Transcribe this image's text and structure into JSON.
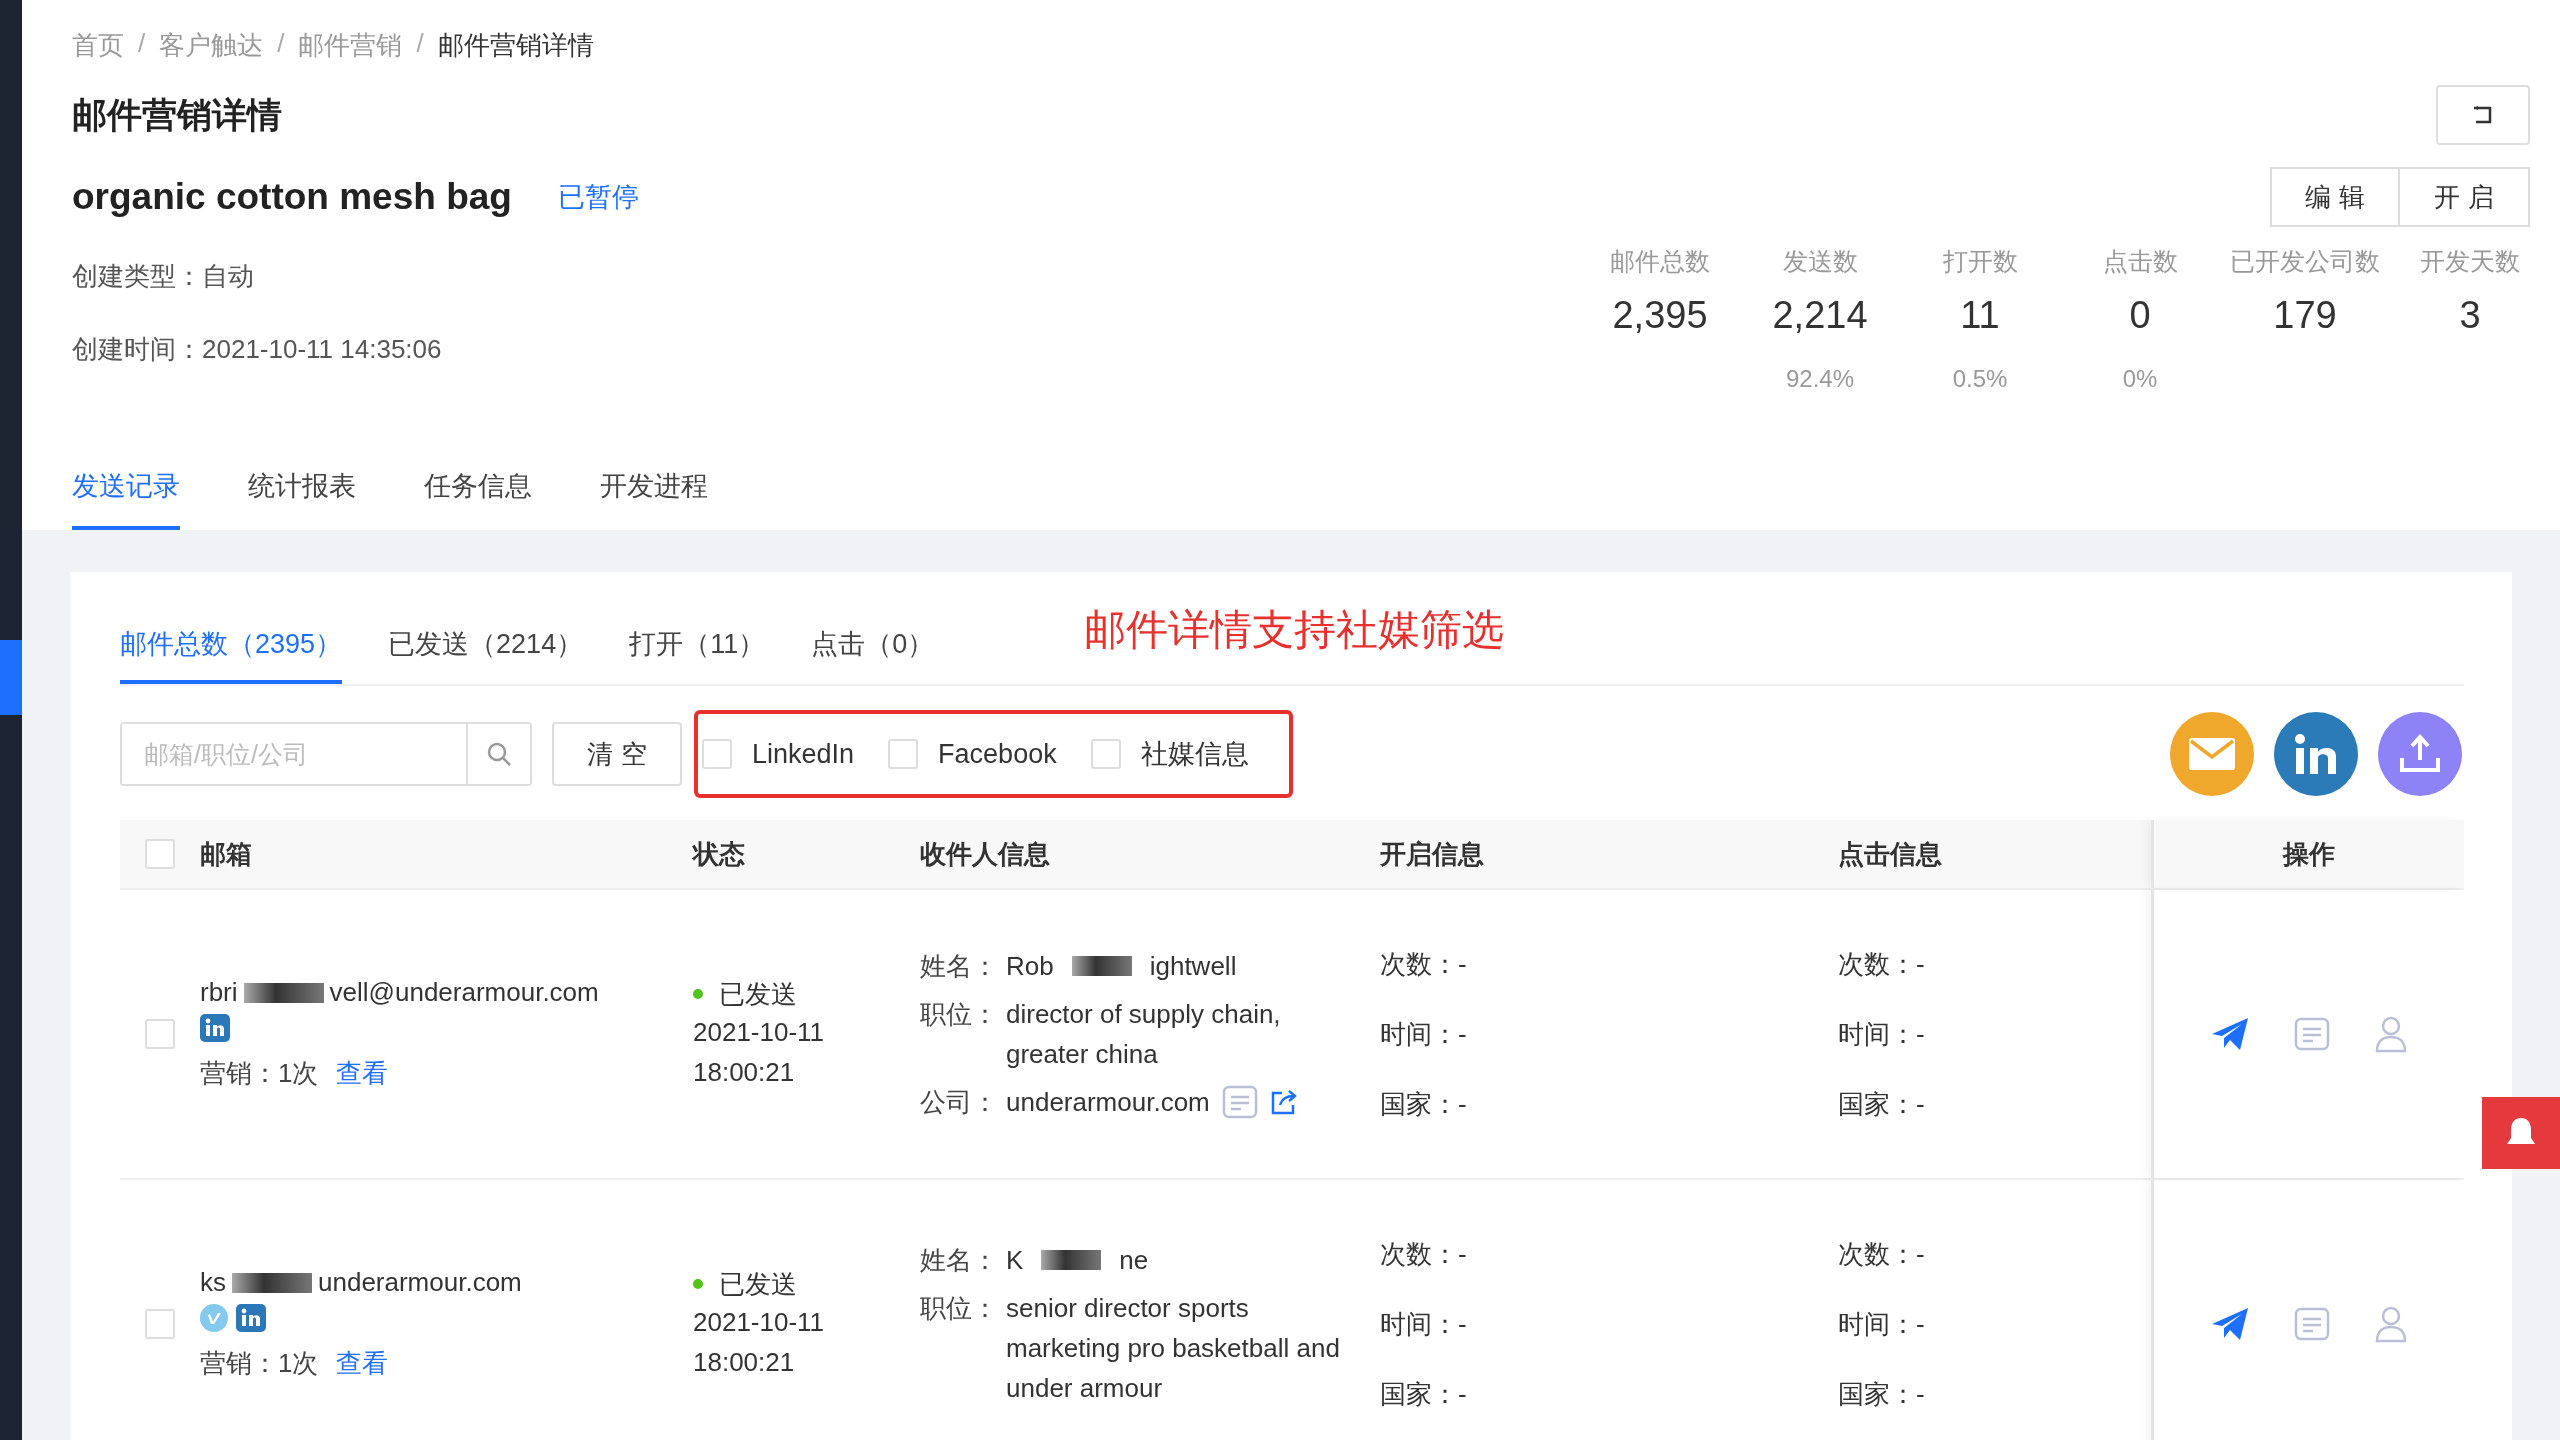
{
  "breadcrumb": [
    "首页",
    "客户触达",
    "邮件营销",
    "邮件营销详情"
  ],
  "breadcrumb_separator": "/",
  "page_title": "邮件营销详情",
  "campaign": {
    "name": "organic cotton mesh bag",
    "status": "已暂停"
  },
  "header_buttons": [
    "编 辑",
    "开 启"
  ],
  "info_lines": [
    "创建类型：自动",
    "创建时间：2021-10-11 14:35:06"
  ],
  "stats": [
    {
      "label": "邮件总数",
      "value": "2,395"
    },
    {
      "label": "发送数",
      "value": "2,214",
      "rate": "92.4%"
    },
    {
      "label": "打开数",
      "value": "11",
      "rate": "0.5%"
    },
    {
      "label": "点击数",
      "value": "0",
      "rate": "0%"
    },
    {
      "label": "已开发公司数",
      "value": "179"
    },
    {
      "label": "开发天数",
      "value": "3"
    }
  ],
  "tabs": [
    {
      "label": "发送记录",
      "selected": true
    },
    {
      "label": "统计报表",
      "selected": false
    },
    {
      "label": "任务信息",
      "selected": false
    },
    {
      "label": "开发进程",
      "selected": false
    }
  ],
  "annotation": "邮件详情支持社媒筛选",
  "sub_tabs": [
    {
      "label": "邮件总数（2395）",
      "selected": true
    },
    {
      "label": "已发送（2214）",
      "selected": false
    },
    {
      "label": "打开（11）",
      "selected": false
    },
    {
      "label": "点击（0）",
      "selected": false
    }
  ],
  "search": {
    "placeholder": "邮箱/职位/公司"
  },
  "clear_button": "清 空",
  "filters": [
    {
      "label": "LinkedIn",
      "checked": false
    },
    {
      "label": "Facebook",
      "checked": false
    },
    {
      "label": "社媒信息",
      "checked": false
    }
  ],
  "table": {
    "header_checked": false,
    "columns": [
      "邮箱",
      "状态",
      "收件人信息",
      "开启信息",
      "点击信息",
      "操作"
    ],
    "rows": [
      {
        "checked": false,
        "email_start": "rbri",
        "email_end": "vell@underarmour.com",
        "socials": [
          {
            "kind": "linkedin"
          }
        ],
        "marketing": "营销：1次",
        "view_link": "查看",
        "status": {
          "kind": "sent",
          "label": "已发送"
        },
        "sent_date": "2021-10-11",
        "sent_time": "18:00:21",
        "name_label": "姓名：",
        "name_start": "Rob",
        "name_end": "ightwell",
        "job_label": "职位：",
        "job": "director of supply chain, greater china",
        "company_label": "公司：",
        "company": "underarmour.com",
        "open_info": [
          "次数：-",
          "时间：-",
          "国家：-"
        ],
        "click_info": [
          "次数：-",
          "时间：-",
          "国家：-"
        ]
      },
      {
        "checked": false,
        "email_start": "ks",
        "email_end": "underarmour.com",
        "socials": [
          {
            "kind": "vimeo"
          },
          {
            "kind": "linkedin"
          }
        ],
        "marketing": "营销：1次",
        "view_link": "查看",
        "status": {
          "kind": "sent",
          "label": "已发送"
        },
        "sent_date": "2021-10-11",
        "sent_time": "18:00:21",
        "name_label": "姓名：",
        "name_start": "K",
        "name_end": "ne",
        "job_label": "职位：",
        "job": "senior director sports marketing pro basketball and under armour",
        "open_info": [
          "次数：-",
          "时间：-",
          "国家：-"
        ],
        "click_info": [
          "次数：-",
          "时间：-",
          "国家：-"
        ]
      }
    ]
  }
}
